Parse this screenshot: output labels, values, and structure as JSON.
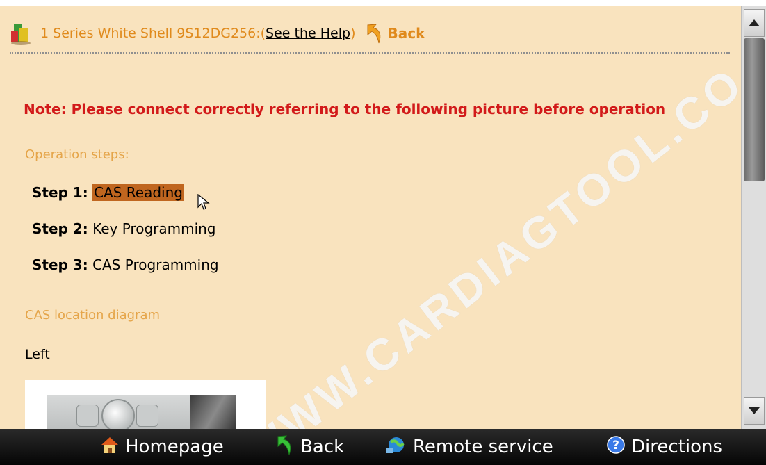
{
  "header": {
    "title": "1 Series White Shell 9S12DG256:",
    "help_open": "(",
    "help_link": "See the Help",
    "help_close": ")",
    "back_label": "Back"
  },
  "note": "Note: Please connect correctly referring to the following picture before operation",
  "operation_steps_label": "Operation steps:",
  "steps": [
    {
      "prefix": "Step 1:",
      "label": "CAS Reading",
      "highlighted": true
    },
    {
      "prefix": "Step 2:",
      "label": "Key Programming",
      "highlighted": false
    },
    {
      "prefix": "Step 3:",
      "label": "CAS Programming",
      "highlighted": false
    }
  ],
  "cas_location_label": "CAS location diagram",
  "left_label": "Left",
  "bottom_bar": {
    "homepage": "Homepage",
    "back": "Back",
    "remote_service": "Remote service",
    "directions": "Directions"
  },
  "watermark": "WWW.CARDIAGTOOL.CO.UK",
  "colors": {
    "background": "#f9e3be",
    "note_red": "#d21a1a",
    "section_orange": "#e5a54a",
    "highlight": "#c0661f",
    "bottom_bar": "#0a0a0a"
  },
  "icons": [
    "app-logo-icon",
    "back-arrow-icon",
    "cursor-icon",
    "scroll-up-icon",
    "scroll-down-icon",
    "home-icon",
    "green-back-icon",
    "remote-service-icon",
    "help-icon"
  ]
}
